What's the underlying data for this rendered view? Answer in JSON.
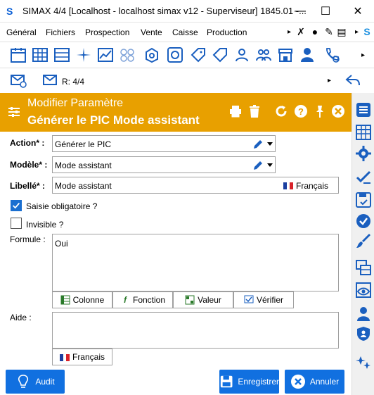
{
  "window": {
    "title": "SIMAX 4/4 [Localhost - localhost simax v12 - Superviseur] 1845.01 -...",
    "logo": "S",
    "minimize": "—",
    "maximize": "☐",
    "close": "✕"
  },
  "menu": {
    "items": [
      "Général",
      "Fichiers",
      "Prospection",
      "Vente",
      "Caisse",
      "Production"
    ],
    "more": "▸",
    "tools_more": "▸"
  },
  "toolbar2": {
    "record_counter": "R: 4/4",
    "more": "▸"
  },
  "header": {
    "subtitle": "Modifier Paramètre",
    "title": "Générer le PIC Mode assistant"
  },
  "form": {
    "action_label": "Action* :",
    "action_value": "Générer le PIC",
    "model_label": "Modèle* :",
    "model_value": "Mode assistant",
    "libelle_label": "Libellé* :",
    "libelle_value": "Mode assistant",
    "libelle_lang": "Français",
    "saisie_label": "Saisie obligatoire ?",
    "saisie_checked": true,
    "invisible_label": "Invisible ?",
    "invisible_checked": false,
    "formule_label": "Formule :",
    "formule_value": "Oui",
    "formule_buttons": [
      "Colonne",
      "Fonction",
      "Valeur",
      "Vérifier"
    ],
    "aide_label": "Aide :",
    "aide_value": "",
    "aide_lang": "Français"
  },
  "footer": {
    "audit": "Audit",
    "save": "Enregistrer",
    "cancel": "Annuler"
  },
  "colors": {
    "accent_blue": "#1170e0",
    "header_orange": "#e8a000",
    "icon_blue": "#1a5fbf"
  }
}
